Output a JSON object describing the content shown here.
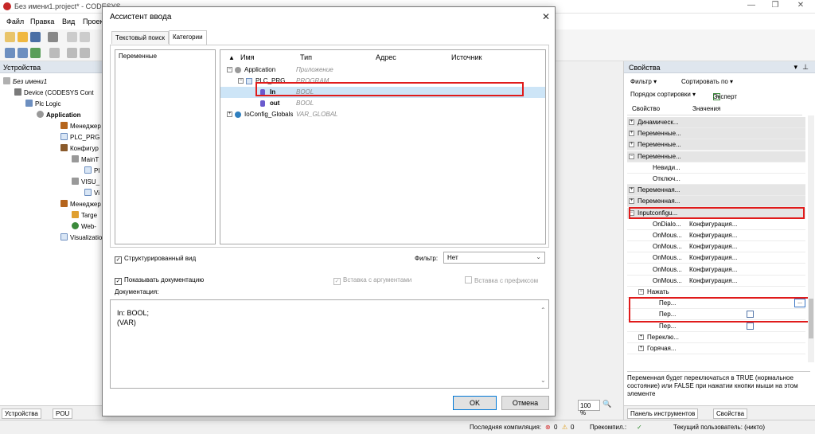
{
  "app": {
    "title": "Без имени1.project* - CODESYS",
    "menu": [
      "Файл",
      "Правка",
      "Вид",
      "Проект"
    ]
  },
  "devices_panel": {
    "title": "Устройства",
    "tree": [
      {
        "label": "Без имени1",
        "italic": true
      },
      {
        "label": "Device (CODESYS Cont"
      },
      {
        "label": "Plc Logic"
      },
      {
        "label": "Application",
        "bold": true
      },
      {
        "label": "Менеджер"
      },
      {
        "label": "PLC_PRG ("
      },
      {
        "label": "Конфигур"
      },
      {
        "label": "MainT"
      },
      {
        "label": "Pl"
      },
      {
        "label": "VISU_"
      },
      {
        "label": "Vi"
      },
      {
        "label": "Менеджер"
      },
      {
        "label": "Targe"
      },
      {
        "label": "Web-"
      },
      {
        "label": "Visualizatio"
      }
    ],
    "bottom_tabs": [
      "Устройства",
      "POU"
    ]
  },
  "dialog": {
    "title": "Ассистент ввода",
    "close": "✕",
    "tabs": [
      "Текстовый поиск",
      "Категории"
    ],
    "categories": [
      "Переменные"
    ],
    "columns": [
      "Имя",
      "Тип",
      "Адрес",
      "Источник"
    ],
    "rows": [
      {
        "name": "Application",
        "type": "Приложение",
        "indent": 0,
        "exp": "⊟"
      },
      {
        "name": "PLC_PRG",
        "type": "PROGRAM",
        "indent": 1,
        "exp": "⊟"
      },
      {
        "name": "In",
        "type": "BOOL",
        "indent": 2,
        "exp": "",
        "selected": true
      },
      {
        "name": "out",
        "type": "BOOL",
        "indent": 2,
        "exp": ""
      },
      {
        "name": "IoConfig_Globals",
        "type": "VAR_GLOBAL",
        "indent": 0,
        "exp": "⊞"
      }
    ],
    "structured_view": "Структурированный вид",
    "filter_label": "Фильтр:",
    "filter_value": "Нет",
    "show_docs": "Показывать документацию",
    "insert_with_args": "Вставка с аргументами",
    "insert_with_prefix": "Вставка с префиксом",
    "docs_label": "Документация:",
    "docs_text": "In: BOOL;\n(VAR)",
    "ok": "OK",
    "cancel": "Отмена"
  },
  "props_panel": {
    "title": "Свойства",
    "filter": "Фильтр ▾",
    "sort_by": "Сортировать по ▾",
    "sort_order": "Порядок сортировки ▾",
    "expert": "Эксперт",
    "col_property": "Свойство",
    "col_values": "Значения",
    "rows": [
      {
        "name": "Динамическ...",
        "group": true,
        "exp": "+",
        "indent": 0
      },
      {
        "name": "Переменные...",
        "group": true,
        "exp": "+",
        "indent": 0
      },
      {
        "name": "Переменные...",
        "group": true,
        "exp": "+",
        "indent": 0
      },
      {
        "name": "Переменные...",
        "group": true,
        "exp": "−",
        "indent": 0
      },
      {
        "name": "Невиди...",
        "indent": 2
      },
      {
        "name": "Отключ...",
        "indent": 2
      },
      {
        "name": "Переменная...",
        "group": true,
        "exp": "+",
        "indent": 0
      },
      {
        "name": "Переменная...",
        "group": true,
        "exp": "+",
        "indent": 0
      },
      {
        "name": "Inputconfigu...",
        "group": true,
        "exp": "−",
        "indent": 0
      },
      {
        "name": "OnDialo...",
        "value": "Конфигурация...",
        "indent": 2
      },
      {
        "name": "OnMous...",
        "value": "Конфигурация...",
        "indent": 2
      },
      {
        "name": "OnMous...",
        "value": "Конфигурация...",
        "indent": 2
      },
      {
        "name": "OnMous...",
        "value": "Конфигурация...",
        "indent": 2
      },
      {
        "name": "OnMous...",
        "value": "Конфигурация...",
        "indent": 2
      },
      {
        "name": "OnMous...",
        "value": "Конфигурация...",
        "indent": 2
      },
      {
        "name": "Нажать",
        "exp": "−",
        "indent": 1
      },
      {
        "name": "Пер...",
        "indent": 3,
        "dots": "..."
      },
      {
        "name": "Пер...",
        "indent": 3,
        "checkbox": true
      },
      {
        "name": "Пер...",
        "indent": 3,
        "checkbox": true
      },
      {
        "name": "Переклю...",
        "exp": "+",
        "indent": 1
      },
      {
        "name": "Горячая...",
        "exp": "+",
        "indent": 1
      }
    ],
    "description": "Переменная будет переключаться в TRUE (нормальное состояние) или FALSE при нажатии кнопки мыши на этом элементе",
    "bottom_tabs": [
      "Панель инструментов",
      "Свойства"
    ]
  },
  "zoom": "100 %",
  "statusbar": {
    "last_compile": "Последняя компиляция:",
    "errors": "0",
    "warnings": "0",
    "precompile": "Прекомпил.:",
    "current_user": "Текущий пользователь: (никто)"
  }
}
